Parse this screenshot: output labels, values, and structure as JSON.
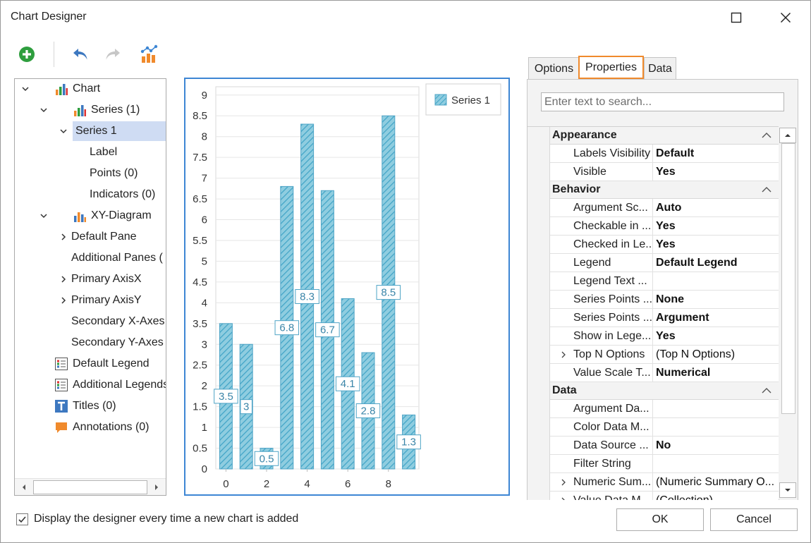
{
  "window": {
    "title": "Chart Designer"
  },
  "toolbar": {
    "items": [
      "add-icon",
      "undo-icon",
      "redo-icon",
      "chart-wizard-icon"
    ]
  },
  "tree": {
    "nodes": [
      {
        "label": "Chart"
      },
      {
        "label": "Series (1)"
      },
      {
        "label": "Series 1"
      },
      {
        "label": "Label"
      },
      {
        "label": "Points (0)"
      },
      {
        "label": "Indicators (0)"
      },
      {
        "label": "XY-Diagram"
      },
      {
        "label": "Default Pane"
      },
      {
        "label": "Additional Panes ("
      },
      {
        "label": "Primary AxisX"
      },
      {
        "label": "Primary AxisY"
      },
      {
        "label": "Secondary X-Axes"
      },
      {
        "label": "Secondary Y-Axes"
      },
      {
        "label": "Default Legend"
      },
      {
        "label": "Additional Legends"
      },
      {
        "label": "Titles (0)"
      },
      {
        "label": "Annotations (0)"
      }
    ]
  },
  "chart_data": {
    "type": "bar",
    "x": [
      0,
      1,
      2,
      3,
      4,
      5,
      6,
      7,
      8,
      9
    ],
    "series": [
      {
        "name": "Series 1",
        "values": [
          3.5,
          3,
          0.5,
          6.8,
          8.3,
          6.7,
          4.1,
          2.8,
          8.5,
          1.3
        ]
      }
    ],
    "data_labels": [
      "3.5",
      "3",
      "0.5",
      "6.8",
      "8.3",
      "6.7",
      "4.1",
      "2.8",
      "8.5",
      "1.3"
    ],
    "x_ticks": [
      "0",
      "2",
      "4",
      "6",
      "8"
    ],
    "y_ticks": [
      "0",
      "0.5",
      "1",
      "1.5",
      "2",
      "2.5",
      "3",
      "3.5",
      "4",
      "4.5",
      "5",
      "5.5",
      "6",
      "6.5",
      "7",
      "7.5",
      "8",
      "8.5",
      "9"
    ],
    "ylim": [
      0,
      9.2
    ],
    "grid": true,
    "legend": "top-right",
    "colors": {
      "bar_fill": "#8fcde0",
      "bar_stripe": "#3fa3c6",
      "bar_border": "#4ea4c6",
      "label_text": "#3a85a8"
    }
  },
  "tabs": [
    {
      "label": "Options"
    },
    {
      "label": "Properties"
    },
    {
      "label": "Data"
    }
  ],
  "search": {
    "placeholder": "Enter text to search..."
  },
  "properties": {
    "categories": [
      {
        "label": "Appearance"
      },
      {
        "label": "Behavior"
      },
      {
        "label": "Data"
      }
    ],
    "rows": [
      {
        "name": "Labels Visibility",
        "value": "Default"
      },
      {
        "name": "Visible",
        "value": "Yes"
      },
      {
        "name": "Argument Sc...",
        "value": "Auto"
      },
      {
        "name": "Checkable in ...",
        "value": "Yes"
      },
      {
        "name": "Checked in Le...",
        "value": "Yes"
      },
      {
        "name": "Legend",
        "value": "Default Legend"
      },
      {
        "name": "Legend Text ...",
        "value": ""
      },
      {
        "name": "Series Points ...",
        "value": "None"
      },
      {
        "name": "Series Points ...",
        "value": "Argument"
      },
      {
        "name": "Show in Lege...",
        "value": "Yes"
      },
      {
        "name": "Top N Options",
        "value": "(Top N Options)"
      },
      {
        "name": "Value Scale T...",
        "value": "Numerical"
      },
      {
        "name": "Argument Da...",
        "value": ""
      },
      {
        "name": "Color Data M...",
        "value": ""
      },
      {
        "name": "Data Source ...",
        "value": "No"
      },
      {
        "name": "Filter String",
        "value": ""
      },
      {
        "name": "Numeric Sum...",
        "value": "(Numeric Summary O..."
      },
      {
        "name": "Value Data M...",
        "value": "(Collection)"
      }
    ]
  },
  "footer": {
    "checkbox_label": "Display the designer every time a new chart is added",
    "checkbox_checked": true,
    "ok_label": "OK",
    "cancel_label": "Cancel"
  },
  "colors": {
    "accent": "#3d86d4",
    "active_tab": "#f08a2c",
    "selection": "#cfdcf3"
  }
}
